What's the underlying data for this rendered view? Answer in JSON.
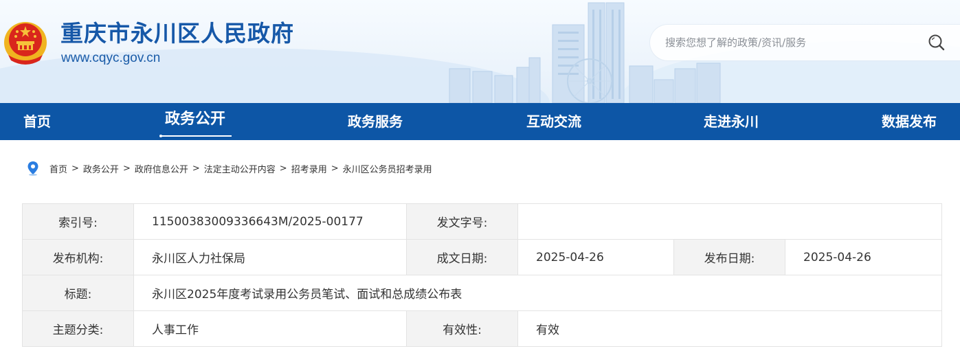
{
  "header": {
    "site_title": "重庆市永川区人民政府",
    "site_url": "www.cqyc.gov.cn",
    "search_placeholder": "搜索您想了解的政策/资讯/服务"
  },
  "nav": {
    "items": [
      {
        "label": "首页"
      },
      {
        "label": "政务公开",
        "active": true
      },
      {
        "label": "政务服务"
      },
      {
        "label": "互动交流"
      },
      {
        "label": "走进永川"
      },
      {
        "label": "数据发布"
      }
    ]
  },
  "breadcrumb": [
    "首页",
    "政务公开",
    "政府信息公开",
    "法定主动公开内容",
    "招考录用",
    "永川区公务员招考录用"
  ],
  "breadcrumb_separator": ">",
  "info": {
    "index_label": "索引号:",
    "index_value": "11500383009336643M/2025-00177",
    "doc_no_label": "发文字号:",
    "doc_no_value": "",
    "org_label": "发布机构:",
    "org_value": "永川区人力社保局",
    "written_label": "成文日期:",
    "written_value": "2025-04-26",
    "published_label": "发布日期:",
    "published_value": "2025-04-26",
    "title_label": "标题:",
    "title_value": "永川区2025年度考试录用公务员笔试、面试和总成绩公布表",
    "topic_label": "主题分类:",
    "topic_value": "人事工作",
    "validity_label": "有效性:",
    "validity_value": "有效"
  },
  "colors": {
    "nav_bg": "#0d56a6",
    "title_blue": "#1658a8",
    "label_bg": "#f3f3f3"
  }
}
